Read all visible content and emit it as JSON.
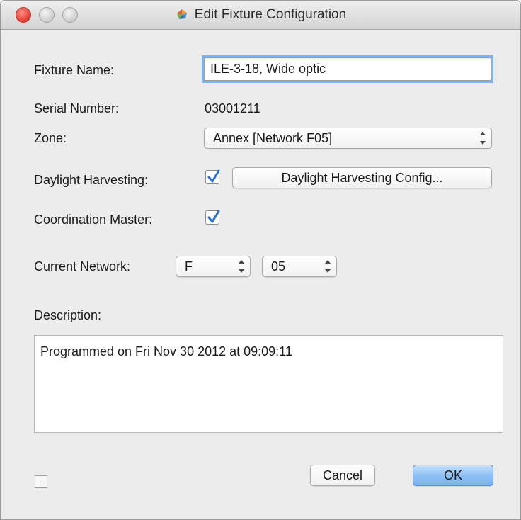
{
  "window": {
    "title": "Edit Fixture Configuration"
  },
  "form": {
    "fixture_name_label": "Fixture Name:",
    "fixture_name_value": "ILE-3-18, Wide optic",
    "serial_number_label": "Serial Number:",
    "serial_number_value": "03001211",
    "zone_label": "Zone:",
    "zone_value": "Annex [Network F05]",
    "daylight_label": "Daylight Harvesting:",
    "daylight_checked": true,
    "daylight_config_button": "Daylight Harvesting Config...",
    "coordination_label": "Coordination Master:",
    "coordination_checked": true,
    "current_network_label": "Current Network:",
    "network_letter": "F",
    "network_number": "05",
    "description_label": "Description:",
    "description_value": "Programmed on Fri Nov 30 2012 at 09:09:11"
  },
  "footer": {
    "minus_label": "-",
    "cancel_label": "Cancel",
    "ok_label": "OK"
  },
  "icons": {
    "close": "close-icon",
    "minimize": "minimize-icon",
    "zoom": "zoom-icon",
    "app": "app-icon",
    "checkmark": "checkmark-icon",
    "popup_arrows": "updown-arrows-icon"
  },
  "colors": {
    "focus_ring": "#7fb3f0",
    "default_button": "#8fc0f5",
    "checkmark": "#2d6fd0",
    "close_button": "#e2463c"
  }
}
